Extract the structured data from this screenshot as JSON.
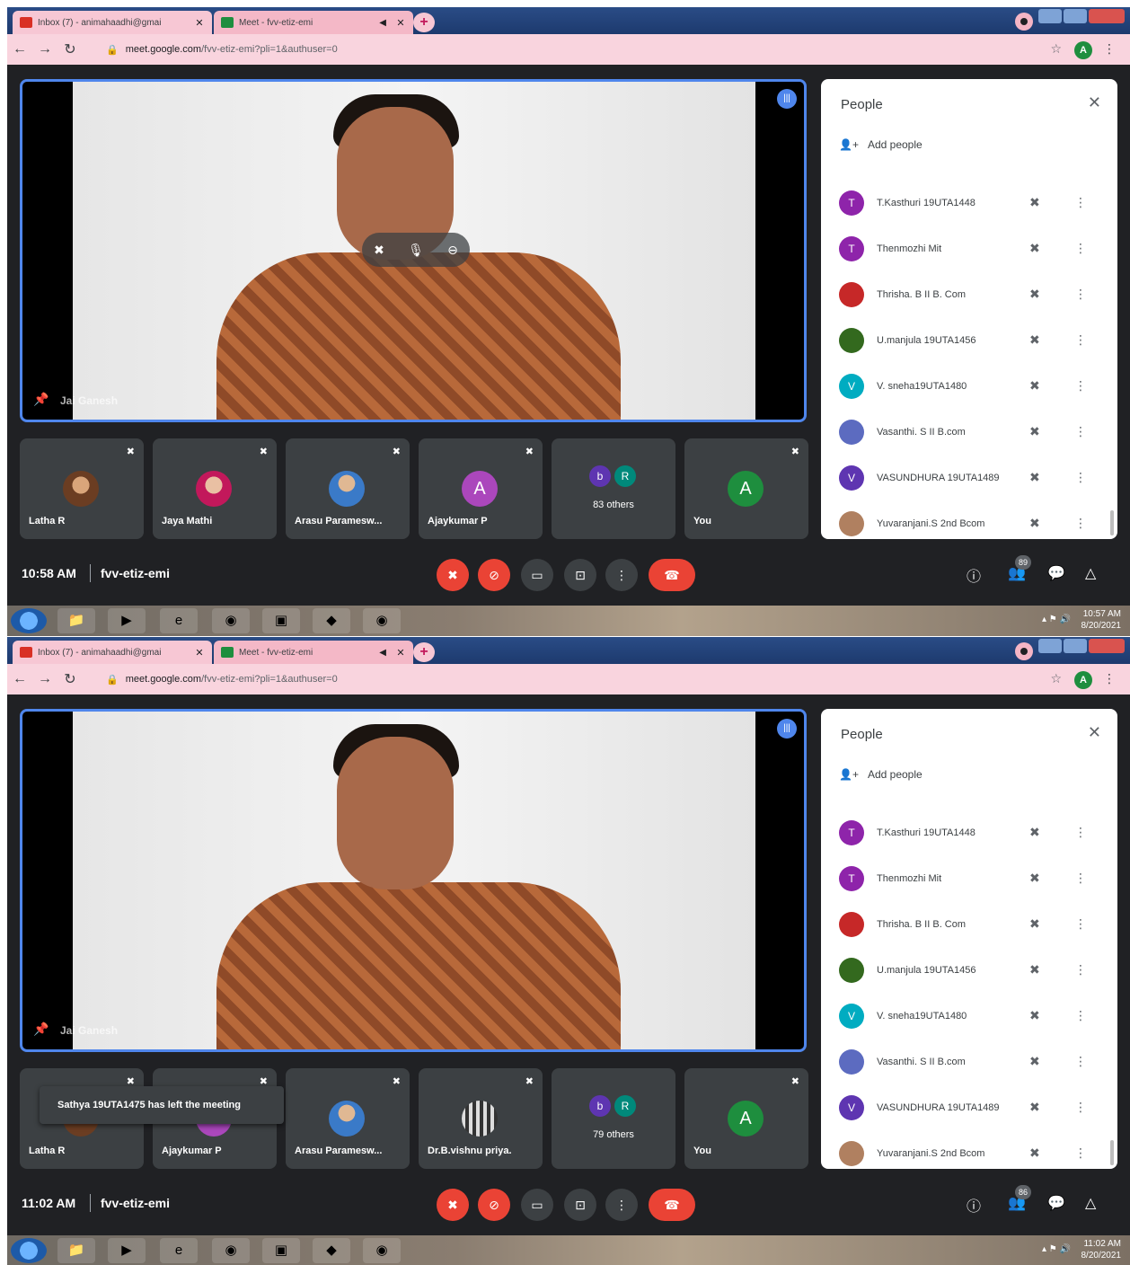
{
  "screens": [
    {
      "browser": {
        "tab1_title": "Inbox (7) - animahaadhi@gmai",
        "tab2_title": "Meet - fvv-etiz-emi",
        "url_host": "meet.google.com",
        "url_path": "/fvv-etiz-emi?pli=1&authuser=0",
        "profile_initial": "A"
      },
      "main_video": {
        "speaker_name": "Jai Ganesh"
      },
      "tiles": [
        {
          "name": "Latha R"
        },
        {
          "name": "Jaya Mathi"
        },
        {
          "name": "Arasu Paramesw..."
        },
        {
          "name": "Ajaykumar P",
          "initial": "A"
        },
        {
          "others_label": "83 others",
          "mini1": "b",
          "mini2": "R"
        },
        {
          "name": "You",
          "initial": "A"
        }
      ],
      "toast": "",
      "people": {
        "title": "People",
        "add_label": "Add people",
        "participants": [
          {
            "name": "T.Kasthuri 19UTA1448",
            "initial": "T",
            "color": "#8e24aa"
          },
          {
            "name": "Thenmozhi Mit",
            "initial": "T",
            "color": "#8e24aa"
          },
          {
            "name": "Thrisha. B II B. Com",
            "initial": "",
            "color": "#c62828"
          },
          {
            "name": "U.manjula 19UTA1456",
            "initial": "",
            "color": "#33691e"
          },
          {
            "name": "V. sneha19UTA1480",
            "initial": "V",
            "color": "#00acc1"
          },
          {
            "name": "Vasanthi. S II B.com",
            "initial": "",
            "color": "#5c6bc0"
          },
          {
            "name": "VASUNDHURA 19UTA1489",
            "initial": "V",
            "color": "#5e35b1"
          },
          {
            "name": "Yuvaranjani.S 2nd Bcom",
            "initial": "",
            "color": "#b08060"
          }
        ]
      },
      "bottom": {
        "time": "10:58 AM",
        "meeting_code": "fvv-etiz-emi",
        "people_count": "89"
      },
      "taskbar": {
        "time": "10:57 AM",
        "date": "8/20/2021"
      }
    },
    {
      "browser": {
        "tab1_title": "Inbox (7) - animahaadhi@gmai",
        "tab2_title": "Meet - fvv-etiz-emi",
        "url_host": "meet.google.com",
        "url_path": "/fvv-etiz-emi?pli=1&authuser=0",
        "profile_initial": "A"
      },
      "main_video": {
        "speaker_name": "Jai Ganesh"
      },
      "tiles": [
        {
          "name": "Latha R"
        },
        {
          "name": "Ajaykumar P"
        },
        {
          "name": "Arasu Paramesw..."
        },
        {
          "name": "Dr.B.vishnu priya."
        },
        {
          "others_label": "79 others",
          "mini1": "b",
          "mini2": "R"
        },
        {
          "name": "You",
          "initial": "A"
        }
      ],
      "toast": "Sathya 19UTA1475 has left the meeting",
      "people": {
        "title": "People",
        "add_label": "Add people",
        "participants": [
          {
            "name": "T.Kasthuri 19UTA1448",
            "initial": "T",
            "color": "#8e24aa"
          },
          {
            "name": "Thenmozhi Mit",
            "initial": "T",
            "color": "#8e24aa"
          },
          {
            "name": "Thrisha. B II B. Com",
            "initial": "",
            "color": "#c62828"
          },
          {
            "name": "U.manjula 19UTA1456",
            "initial": "",
            "color": "#33691e"
          },
          {
            "name": "V. sneha19UTA1480",
            "initial": "V",
            "color": "#00acc1"
          },
          {
            "name": "Vasanthi. S II B.com",
            "initial": "",
            "color": "#5c6bc0"
          },
          {
            "name": "VASUNDHURA 19UTA1489",
            "initial": "V",
            "color": "#5e35b1"
          },
          {
            "name": "Yuvaranjani.S 2nd Bcom",
            "initial": "",
            "color": "#b08060"
          }
        ]
      },
      "bottom": {
        "time": "11:02 AM",
        "meeting_code": "fvv-etiz-emi",
        "people_count": "86"
      },
      "taskbar": {
        "time": "11:02 AM",
        "date": "8/20/2021"
      }
    }
  ]
}
